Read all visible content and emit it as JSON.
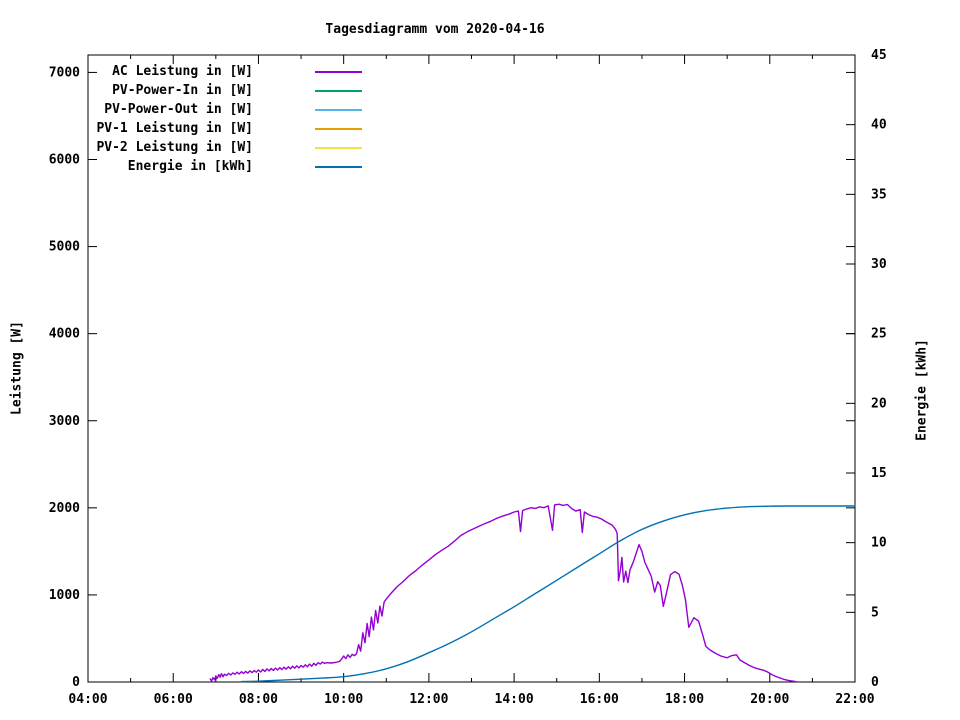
{
  "chart_data": {
    "type": "line",
    "title": "Tagesdiagramm vom 2020-04-16",
    "grid": false,
    "legend_position": "top-left-inside",
    "x_axis": {
      "kind": "time-of-day",
      "range_hours": [
        4,
        22
      ],
      "major_tick_step_hours": 2,
      "minor_tick_step_hours": 1,
      "tick_labels": [
        "04:00",
        "06:00",
        "08:00",
        "10:00",
        "12:00",
        "14:00",
        "16:00",
        "18:00",
        "20:00",
        "22:00"
      ]
    },
    "y_left": {
      "label": "Leistung [W]",
      "range": [
        0,
        7200
      ],
      "ticks": [
        0,
        1000,
        2000,
        3000,
        4000,
        5000,
        6000,
        7000
      ],
      "tick_labels": [
        "0",
        "1000",
        "2000",
        "3000",
        "4000",
        "5000",
        "6000",
        "7000"
      ]
    },
    "y_right": {
      "label": "Energie [kWh]",
      "range": [
        0,
        45
      ],
      "ticks": [
        0,
        5,
        10,
        15,
        20,
        25,
        30,
        35,
        40,
        45
      ],
      "tick_labels": [
        "0",
        "5",
        "10",
        "15",
        "20",
        "25",
        "30",
        "35",
        "40",
        "45"
      ]
    },
    "legend": [
      {
        "label": "AC Leistung in [W]",
        "color": "#9400D3"
      },
      {
        "label": "PV-Power-In in [W]",
        "color": "#009E73"
      },
      {
        "label": "PV-Power-Out in [W]",
        "color": "#56B4E9"
      },
      {
        "label": "PV-1 Leistung in [W]",
        "color": "#E69F00"
      },
      {
        "label": "PV-2 Leistung in [W]",
        "color": "#F0E442"
      },
      {
        "label": "Energie in [kWh]",
        "color": "#0072B2"
      }
    ],
    "series": [
      {
        "name": "AC Leistung in [W]",
        "color": "#9400D3",
        "axis": "left",
        "smooth": false,
        "points": [
          [
            6.87,
            35
          ],
          [
            6.9,
            12
          ],
          [
            6.93,
            50
          ],
          [
            6.97,
            25
          ],
          [
            7.0,
            70
          ],
          [
            7.03,
            40
          ],
          [
            7.07,
            85
          ],
          [
            7.1,
            55
          ],
          [
            7.13,
            95
          ],
          [
            7.17,
            60
          ],
          [
            7.2,
            90
          ],
          [
            7.25,
            75
          ],
          [
            7.3,
            100
          ],
          [
            7.35,
            80
          ],
          [
            7.4,
            105
          ],
          [
            7.45,
            88
          ],
          [
            7.5,
            112
          ],
          [
            7.55,
            92
          ],
          [
            7.6,
            118
          ],
          [
            7.65,
            98
          ],
          [
            7.7,
            122
          ],
          [
            7.75,
            102
          ],
          [
            7.8,
            128
          ],
          [
            7.85,
            108
          ],
          [
            7.9,
            132
          ],
          [
            7.95,
            112
          ],
          [
            8.0,
            138
          ],
          [
            8.05,
            115
          ],
          [
            8.1,
            145
          ],
          [
            8.15,
            120
          ],
          [
            8.2,
            150
          ],
          [
            8.25,
            128
          ],
          [
            8.3,
            155
          ],
          [
            8.35,
            132
          ],
          [
            8.4,
            160
          ],
          [
            8.45,
            138
          ],
          [
            8.5,
            165
          ],
          [
            8.55,
            142
          ],
          [
            8.6,
            170
          ],
          [
            8.65,
            148
          ],
          [
            8.7,
            175
          ],
          [
            8.75,
            152
          ],
          [
            8.8,
            180
          ],
          [
            8.85,
            158
          ],
          [
            8.9,
            185
          ],
          [
            8.95,
            162
          ],
          [
            9.0,
            190
          ],
          [
            9.05,
            170
          ],
          [
            9.1,
            198
          ],
          [
            9.15,
            175
          ],
          [
            9.2,
            205
          ],
          [
            9.25,
            182
          ],
          [
            9.3,
            215
          ],
          [
            9.35,
            192
          ],
          [
            9.4,
            222
          ],
          [
            9.45,
            205
          ],
          [
            9.5,
            228
          ],
          [
            9.55,
            215
          ],
          [
            9.6,
            222
          ],
          [
            9.7,
            218
          ],
          [
            9.8,
            224
          ],
          [
            9.9,
            235
          ],
          [
            9.95,
            262
          ],
          [
            10.0,
            298
          ],
          [
            10.05,
            268
          ],
          [
            10.1,
            312
          ],
          [
            10.15,
            282
          ],
          [
            10.2,
            318
          ],
          [
            10.25,
            302
          ],
          [
            10.3,
            325
          ],
          [
            10.35,
            430
          ],
          [
            10.4,
            355
          ],
          [
            10.45,
            565
          ],
          [
            10.5,
            450
          ],
          [
            10.55,
            672
          ],
          [
            10.6,
            520
          ],
          [
            10.65,
            745
          ],
          [
            10.7,
            598
          ],
          [
            10.75,
            822
          ],
          [
            10.8,
            678
          ],
          [
            10.85,
            872
          ],
          [
            10.9,
            758
          ],
          [
            10.95,
            918
          ],
          [
            11.0,
            952
          ],
          [
            11.1,
            1012
          ],
          [
            11.25,
            1092
          ],
          [
            11.4,
            1155
          ],
          [
            11.55,
            1225
          ],
          [
            11.7,
            1282
          ],
          [
            11.85,
            1345
          ],
          [
            12.0,
            1402
          ],
          [
            12.15,
            1462
          ],
          [
            12.3,
            1512
          ],
          [
            12.45,
            1558
          ],
          [
            12.6,
            1618
          ],
          [
            12.75,
            1682
          ],
          [
            12.9,
            1725
          ],
          [
            13.0,
            1748
          ],
          [
            13.15,
            1782
          ],
          [
            13.3,
            1815
          ],
          [
            13.45,
            1845
          ],
          [
            13.6,
            1882
          ],
          [
            13.75,
            1908
          ],
          [
            13.9,
            1932
          ],
          [
            14.0,
            1952
          ],
          [
            14.1,
            1962
          ],
          [
            14.15,
            1728
          ],
          [
            14.2,
            1968
          ],
          [
            14.3,
            1988
          ],
          [
            14.4,
            2002
          ],
          [
            14.5,
            1992
          ],
          [
            14.6,
            2012
          ],
          [
            14.7,
            2002
          ],
          [
            14.8,
            2022
          ],
          [
            14.9,
            1742
          ],
          [
            14.95,
            2032
          ],
          [
            15.05,
            2042
          ],
          [
            15.15,
            2028
          ],
          [
            15.25,
            2038
          ],
          [
            15.35,
            1992
          ],
          [
            15.45,
            1962
          ],
          [
            15.55,
            1978
          ],
          [
            15.6,
            1718
          ],
          [
            15.65,
            1952
          ],
          [
            15.75,
            1922
          ],
          [
            15.85,
            1902
          ],
          [
            15.95,
            1892
          ],
          [
            16.05,
            1872
          ],
          [
            16.15,
            1842
          ],
          [
            16.3,
            1802
          ],
          [
            16.38,
            1752
          ],
          [
            16.42,
            1705
          ],
          [
            16.45,
            1162
          ],
          [
            16.5,
            1302
          ],
          [
            16.53,
            1432
          ],
          [
            16.57,
            1148
          ],
          [
            16.62,
            1272
          ],
          [
            16.67,
            1142
          ],
          [
            16.72,
            1288
          ],
          [
            16.8,
            1382
          ],
          [
            16.93,
            1578
          ],
          [
            17.0,
            1502
          ],
          [
            17.07,
            1372
          ],
          [
            17.15,
            1288
          ],
          [
            17.22,
            1212
          ],
          [
            17.3,
            1032
          ],
          [
            17.37,
            1152
          ],
          [
            17.43,
            1108
          ],
          [
            17.5,
            868
          ],
          [
            17.57,
            1008
          ],
          [
            17.67,
            1232
          ],
          [
            17.77,
            1268
          ],
          [
            17.87,
            1238
          ],
          [
            17.95,
            1108
          ],
          [
            18.02,
            948
          ],
          [
            18.1,
            628
          ],
          [
            18.22,
            738
          ],
          [
            18.33,
            698
          ],
          [
            18.42,
            548
          ],
          [
            18.5,
            408
          ],
          [
            18.6,
            368
          ],
          [
            18.72,
            332
          ],
          [
            18.85,
            298
          ],
          [
            19.0,
            278
          ],
          [
            19.1,
            302
          ],
          [
            19.22,
            312
          ],
          [
            19.3,
            252
          ],
          [
            19.42,
            218
          ],
          [
            19.53,
            188
          ],
          [
            19.65,
            162
          ],
          [
            19.75,
            148
          ],
          [
            19.85,
            135
          ],
          [
            19.95,
            115
          ],
          [
            20.05,
            85
          ],
          [
            20.15,
            62
          ],
          [
            20.25,
            45
          ],
          [
            20.35,
            28
          ],
          [
            20.45,
            16
          ],
          [
            20.55,
            9
          ],
          [
            20.62,
            4
          ]
        ]
      },
      {
        "name": "PV-Power-In in [W]",
        "color": "#009E73",
        "axis": "left",
        "smooth": false,
        "points": []
      },
      {
        "name": "PV-Power-Out in [W]",
        "color": "#56B4E9",
        "axis": "left",
        "smooth": false,
        "points": []
      },
      {
        "name": "PV-1 Leistung in [W]",
        "color": "#E69F00",
        "axis": "left",
        "smooth": false,
        "points": []
      },
      {
        "name": "PV-2 Leistung in [W]",
        "color": "#F0E442",
        "axis": "left",
        "smooth": false,
        "points": []
      },
      {
        "name": "Energie in [kWh]",
        "color": "#0072B2",
        "axis": "right",
        "smooth": true,
        "points": [
          [
            7.6,
            0.03
          ],
          [
            8.0,
            0.06
          ],
          [
            8.5,
            0.13
          ],
          [
            9.0,
            0.2
          ],
          [
            9.5,
            0.28
          ],
          [
            10.0,
            0.38
          ],
          [
            10.5,
            0.6
          ],
          [
            11.0,
            0.95
          ],
          [
            11.5,
            1.45
          ],
          [
            12.0,
            2.1
          ],
          [
            12.5,
            2.8
          ],
          [
            13.0,
            3.6
          ],
          [
            13.5,
            4.5
          ],
          [
            14.0,
            5.4
          ],
          [
            14.5,
            6.35
          ],
          [
            15.0,
            7.3
          ],
          [
            15.5,
            8.25
          ],
          [
            16.0,
            9.2
          ],
          [
            16.5,
            10.15
          ],
          [
            17.0,
            10.95
          ],
          [
            17.5,
            11.55
          ],
          [
            18.0,
            12.0
          ],
          [
            18.5,
            12.3
          ],
          [
            19.0,
            12.48
          ],
          [
            19.5,
            12.58
          ],
          [
            20.0,
            12.62
          ],
          [
            20.5,
            12.63
          ],
          [
            21.0,
            12.63
          ],
          [
            21.5,
            12.63
          ],
          [
            22.0,
            12.63
          ]
        ]
      }
    ]
  }
}
